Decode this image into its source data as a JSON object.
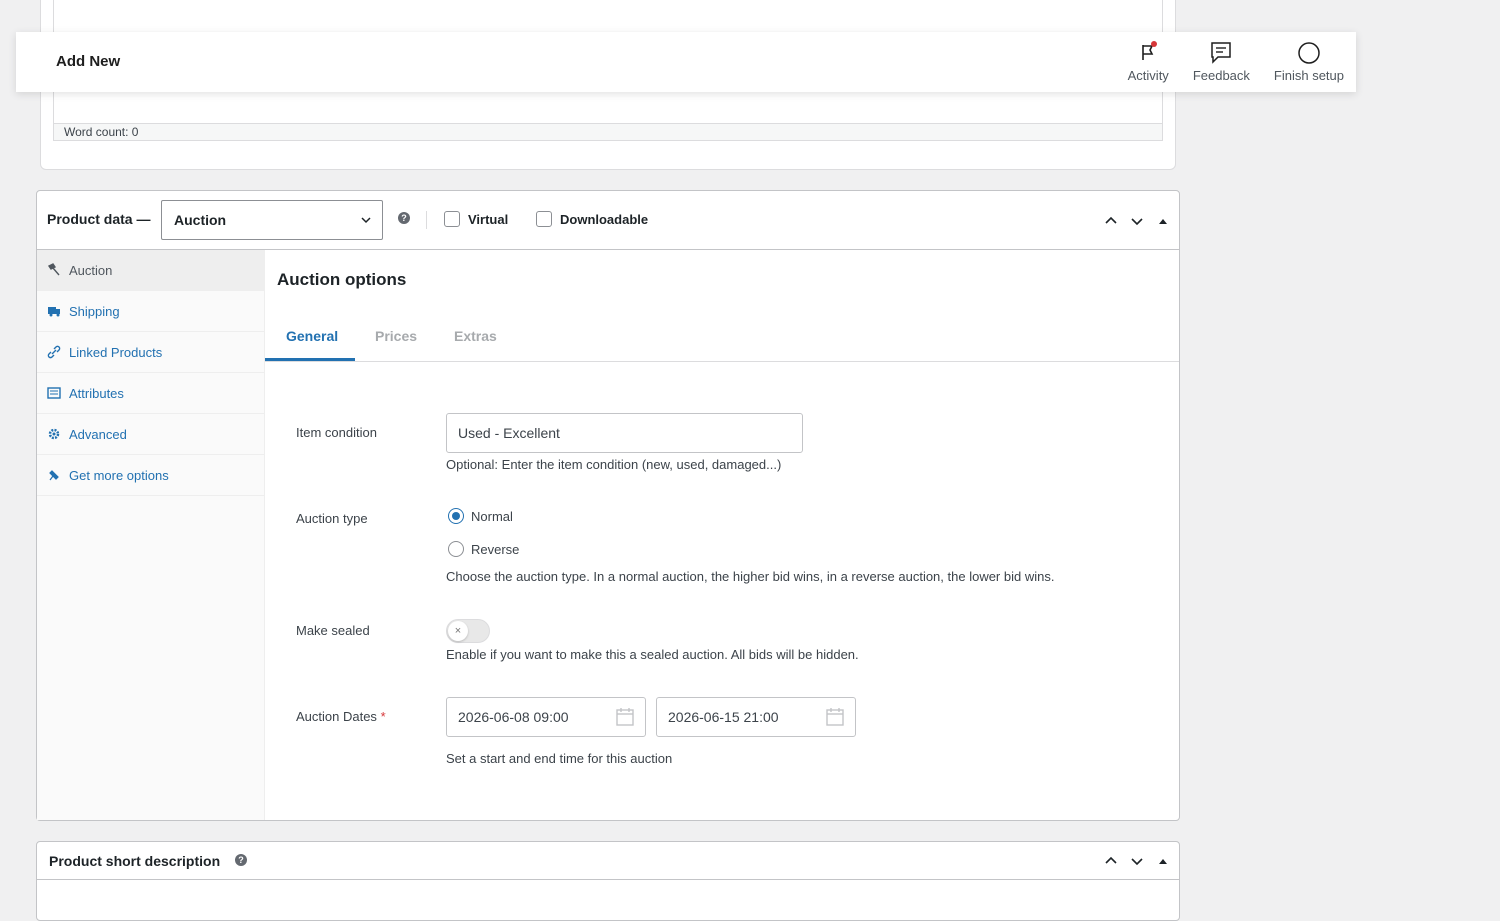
{
  "editor": {
    "word_count": "Word count: 0"
  },
  "header": {
    "title": "Add New",
    "actions": [
      {
        "label": "Activity",
        "icon": "activity-flag-icon"
      },
      {
        "label": "Feedback",
        "icon": "feedback-icon"
      },
      {
        "label": "Finish setup",
        "icon": "circle-icon"
      }
    ]
  },
  "product_data": {
    "label": "Product data —",
    "type_select": "Auction",
    "virtual_label": "Virtual",
    "downloadable_label": "Downloadable",
    "tabs": [
      {
        "label": "Auction",
        "icon": "gavel-icon",
        "active": true
      },
      {
        "label": "Shipping",
        "icon": "truck-icon"
      },
      {
        "label": "Linked Products",
        "icon": "link-icon"
      },
      {
        "label": "Attributes",
        "icon": "list-icon"
      },
      {
        "label": "Advanced",
        "icon": "gear-icon"
      },
      {
        "label": "Get more options",
        "icon": "plugin-icon"
      }
    ],
    "panel": {
      "title": "Auction options",
      "sub_tabs": [
        "General",
        "Prices",
        "Extras"
      ],
      "item_condition": {
        "label": "Item condition",
        "value": "Used - Excellent",
        "description": "Optional: Enter the item condition (new, used, damaged...)"
      },
      "auction_type": {
        "label": "Auction type",
        "options": [
          "Normal",
          "Reverse"
        ],
        "selected": "Normal",
        "description": "Choose the auction type. In a normal auction, the higher bid wins, in a reverse auction, the lower bid wins."
      },
      "make_sealed": {
        "label": "Make sealed",
        "enabled": false,
        "toggle_glyph": "×",
        "description": "Enable if you want to make this a sealed auction. All bids will be hidden."
      },
      "auction_dates": {
        "label": "Auction Dates",
        "required_mark": "*",
        "start": "2026-06-08 09:00",
        "end": "2026-06-15 21:00",
        "description": "Set a start and end time for this auction"
      }
    }
  },
  "short_description": {
    "label": "Product short description"
  },
  "colors": {
    "accent": "#2271b1",
    "notification_dot": "#d63638"
  }
}
